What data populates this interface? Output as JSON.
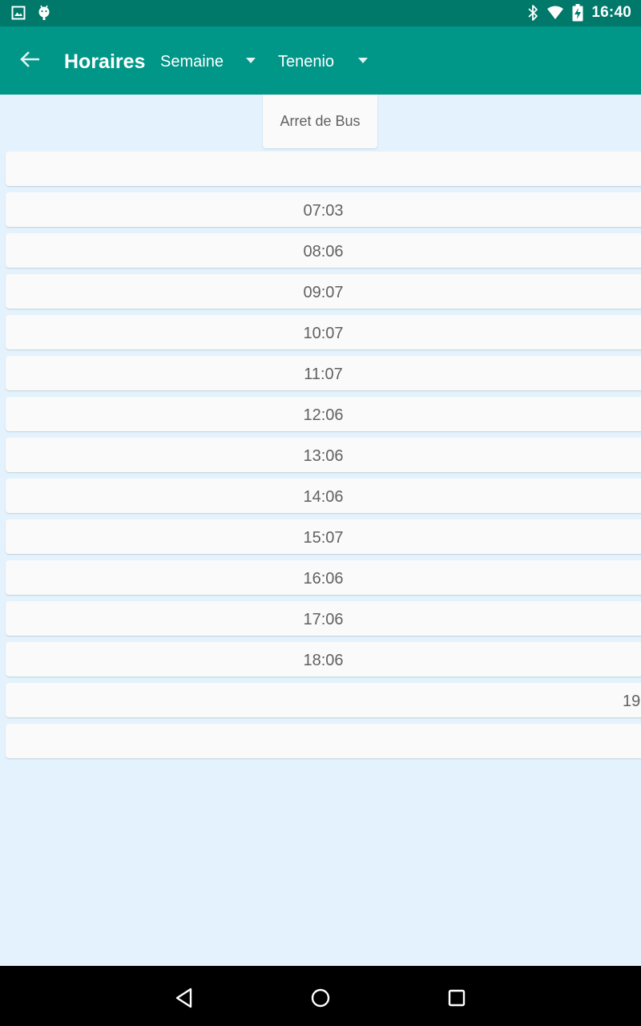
{
  "status_bar": {
    "time": "16:40",
    "icons": [
      "image-icon",
      "android-icon",
      "bluetooth-icon",
      "wifi-icon",
      "battery-charging-icon"
    ]
  },
  "app_bar": {
    "title": "Horaires",
    "period_selected": "Semaine",
    "stop_selected": "Tenenio",
    "background": "#009688",
    "status_background": "#00796b"
  },
  "table": {
    "header": "Arret de Bus",
    "rows": [
      "",
      "07:03",
      "08:06",
      "09:07",
      "10:07",
      "11:07",
      "12:06",
      "13:06",
      "14:06",
      "15:07",
      "16:06",
      "17:06",
      "18:06",
      "19",
      ""
    ]
  },
  "nav_bar": {
    "icons": [
      "back-triangle-icon",
      "home-circle-icon",
      "recents-square-icon"
    ]
  },
  "colors": {
    "content_background": "#e3f2fd",
    "row_background": "#fafafa",
    "text": "#616161"
  }
}
